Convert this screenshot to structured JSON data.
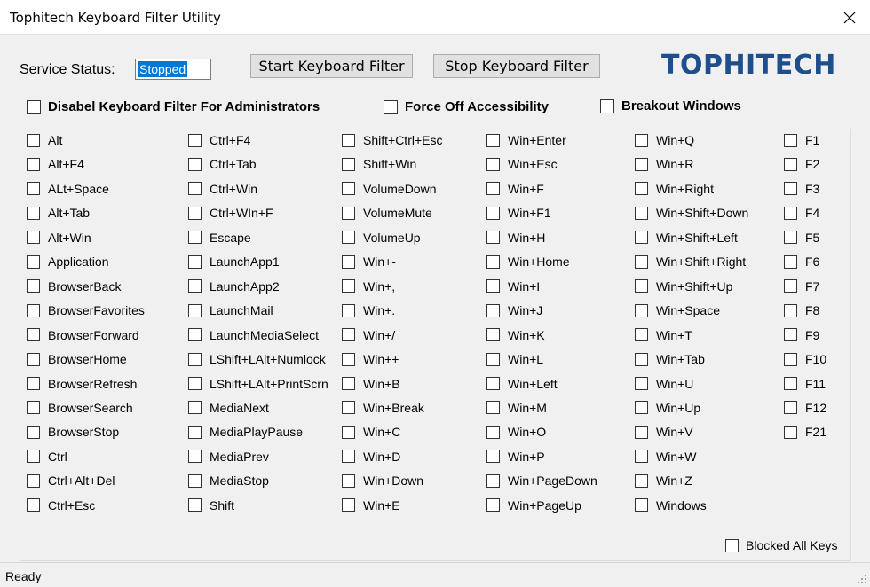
{
  "window": {
    "title": "Tophitech Keyboard Filter Utility"
  },
  "service": {
    "label": "Service Status:",
    "value": "Stopped"
  },
  "buttons": {
    "start": "Start Keyboard Filter",
    "stop": "Stop Keyboard Filter"
  },
  "logo": "TOPHITECH",
  "options": {
    "disable_admin": "Disabel Keyboard Filter For Administrators",
    "force_off": "Force Off Accessibility",
    "breakout": "Breakout Windows"
  },
  "columns": [
    [
      "Alt",
      "Alt+F4",
      "ALt+Space",
      "Alt+Tab",
      "Alt+Win",
      "Application",
      "BrowserBack",
      "BrowserFavorites",
      "BrowserForward",
      "BrowserHome",
      "BrowserRefresh",
      "BrowserSearch",
      "BrowserStop",
      "Ctrl",
      "Ctrl+Alt+Del",
      "Ctrl+Esc"
    ],
    [
      "Ctrl+F4",
      "Ctrl+Tab",
      "Ctrl+Win",
      "Ctrl+WIn+F",
      "Escape",
      "LaunchApp1",
      "LaunchApp2",
      "LaunchMail",
      "LaunchMediaSelect",
      "LShift+LAlt+Numlock",
      "LShift+LAlt+PrintScrn",
      "MediaNext",
      "MediaPlayPause",
      "MediaPrev",
      "MediaStop",
      "Shift"
    ],
    [
      "Shift+Ctrl+Esc",
      "Shift+Win",
      "VolumeDown",
      "VolumeMute",
      "VolumeUp",
      "Win+-",
      "Win+,",
      "Win+.",
      "Win+/",
      "Win++",
      "Win+B",
      "Win+Break",
      "Win+C",
      "Win+D",
      "Win+Down",
      "Win+E"
    ],
    [
      "Win+Enter",
      "Win+Esc",
      "Win+F",
      "Win+F1",
      "Win+H",
      "Win+Home",
      "Win+I",
      "Win+J",
      "Win+K",
      "Win+L",
      "Win+Left",
      "Win+M",
      "Win+O",
      "Win+P",
      "Win+PageDown",
      "Win+PageUp"
    ],
    [
      "Win+Q",
      "Win+R",
      "Win+Right",
      "Win+Shift+Down",
      "Win+Shift+Left",
      "Win+Shift+Right",
      "Win+Shift+Up",
      "Win+Space",
      "Win+T",
      "Win+Tab",
      "Win+U",
      "Win+Up",
      "Win+V",
      "Win+W",
      "Win+Z",
      "Windows"
    ],
    [
      "F1",
      "F2",
      "F3",
      "F4",
      "F5",
      "F6",
      "F7",
      "F8",
      "F9",
      "F10",
      "F11",
      "F12",
      "F21"
    ]
  ],
  "blocked_all": "Blocked All Keys",
  "statusbar": {
    "text": "Ready"
  },
  "colors": {
    "accent": "#0078d7",
    "logo": "#1f4e8c"
  }
}
